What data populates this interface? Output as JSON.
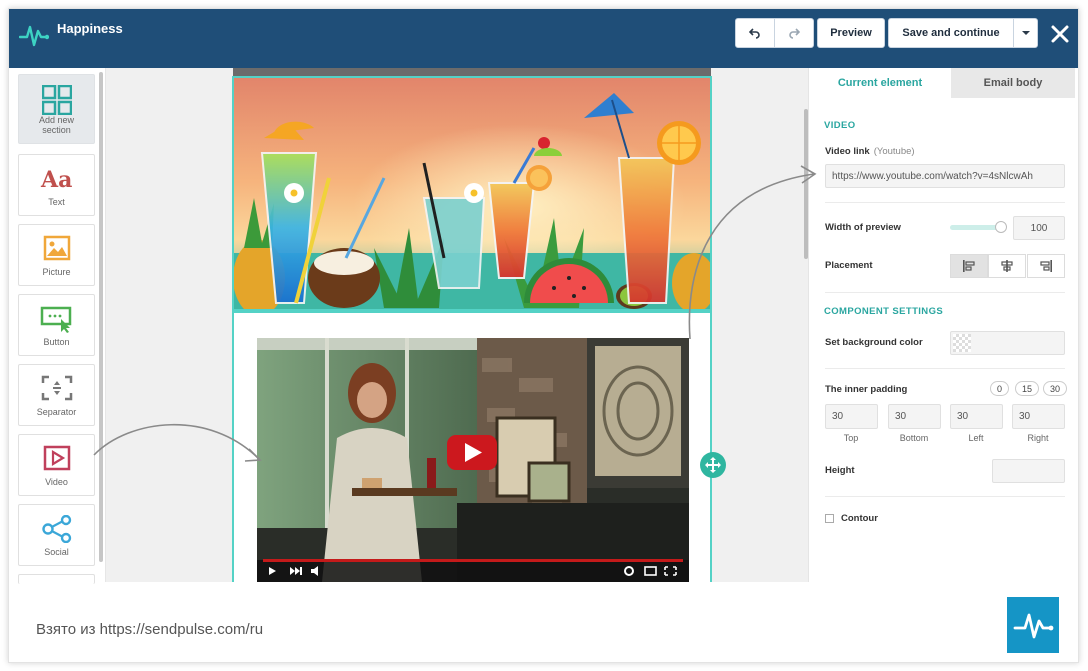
{
  "header": {
    "title": "Happiness",
    "preview_label": "Preview",
    "save_label": "Save and continue"
  },
  "sidebar": {
    "items": [
      {
        "label": "Add new section",
        "icon": "grid-icon"
      },
      {
        "label": "Text",
        "icon": "text-aa-icon"
      },
      {
        "label": "Picture",
        "icon": "picture-icon"
      },
      {
        "label": "Button",
        "icon": "button-cursor-icon"
      },
      {
        "label": "Separator",
        "icon": "separator-icon"
      },
      {
        "label": "Video",
        "icon": "video-play-icon"
      },
      {
        "label": "Social",
        "icon": "share-icon"
      }
    ]
  },
  "panel": {
    "tabs": [
      "Current element",
      "Email body"
    ],
    "video_section_title": "VIDEO",
    "video_link_label": "Video link",
    "video_link_sub": "(Youtube)",
    "video_link_value": "https://www.youtube.com/watch?v=4sNlcwAh",
    "width_label": "Width of preview",
    "width_value": "100",
    "placement_label": "Placement",
    "component_title": "COMPONENT SETTINGS",
    "bg_color_label": "Set background color",
    "padding_label": "The inner padding",
    "padding_presets": [
      "0",
      "15",
      "30"
    ],
    "padding": {
      "top": {
        "value": "30",
        "label": "Top"
      },
      "bottom": {
        "value": "30",
        "label": "Bottom"
      },
      "left": {
        "value": "30",
        "label": "Left"
      },
      "right": {
        "value": "30",
        "label": "Right"
      }
    },
    "height_label": "Height",
    "height_value": "",
    "contour_label": "Contour"
  },
  "footer": {
    "source_text": "Взято из https://sendpulse.com/ru"
  },
  "colors": {
    "header_bg": "#1f4e78",
    "accent": "#2aa6a0",
    "selection_border": "#54d2c6",
    "youtube_red": "#cc181e",
    "footer_logo_bg": "#1595c6"
  }
}
